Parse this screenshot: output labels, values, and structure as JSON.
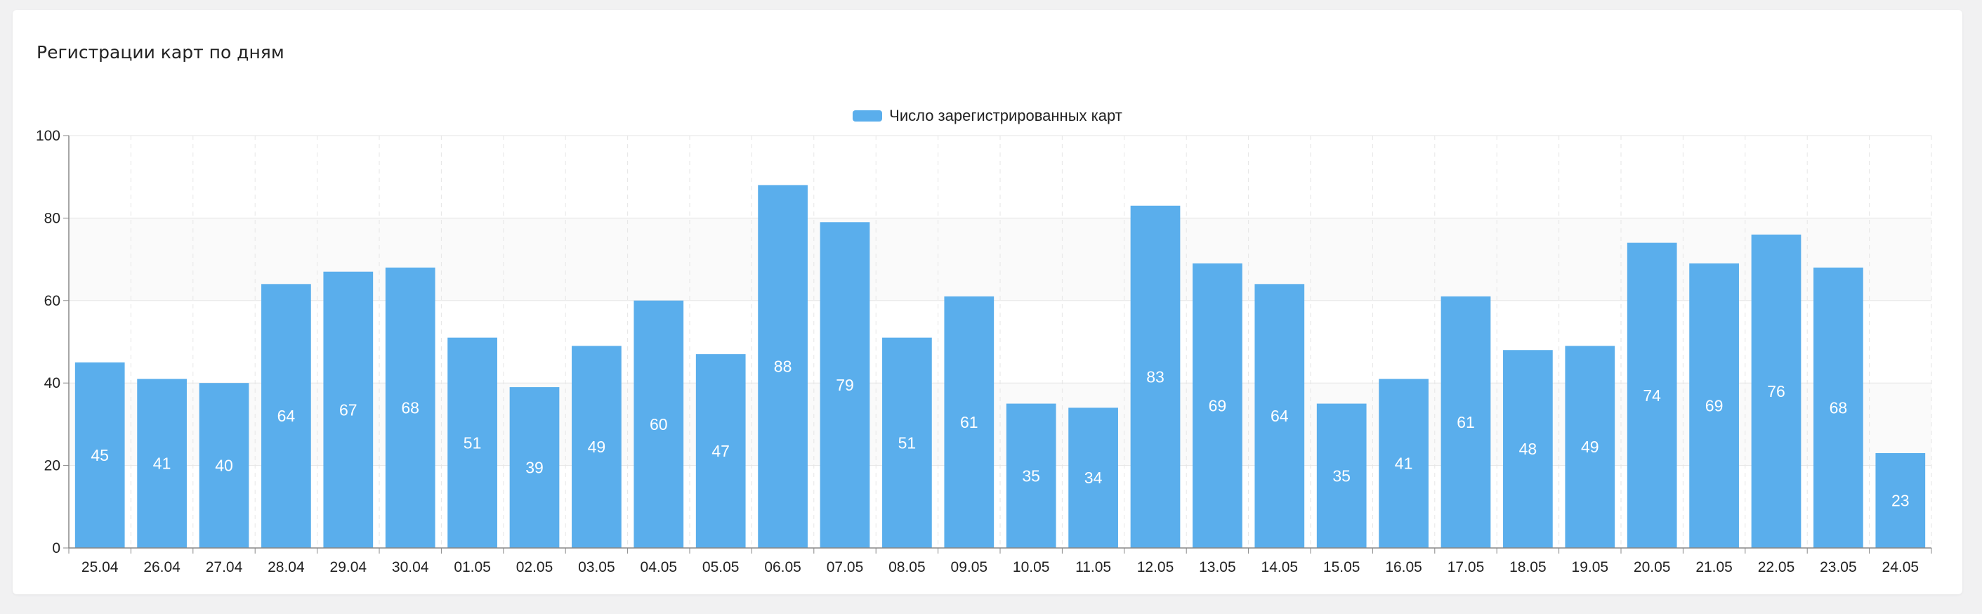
{
  "card": {
    "title": "Регистрации карт по дням"
  },
  "colors": {
    "bar": "#5aaeec",
    "grid": "#e6e6e6",
    "axis": "#888888",
    "band": "#fafafa"
  },
  "chart_data": {
    "type": "bar",
    "title": "Регистрации карт по дням",
    "xlabel": "",
    "ylabel": "",
    "ylim": [
      0,
      100
    ],
    "yticks": [
      0,
      20,
      40,
      60,
      80,
      100
    ],
    "grid": true,
    "legend_position": "top-center",
    "categories": [
      "25.04",
      "26.04",
      "27.04",
      "28.04",
      "29.04",
      "30.04",
      "01.05",
      "02.05",
      "03.05",
      "04.05",
      "05.05",
      "06.05",
      "07.05",
      "08.05",
      "09.05",
      "10.05",
      "11.05",
      "12.05",
      "13.05",
      "14.05",
      "15.05",
      "16.05",
      "17.05",
      "18.05",
      "19.05",
      "20.05",
      "21.05",
      "22.05",
      "23.05",
      "24.05"
    ],
    "series": [
      {
        "name": "Число зарегистрированных карт",
        "values": [
          45,
          41,
          40,
          64,
          67,
          68,
          51,
          39,
          49,
          60,
          47,
          88,
          79,
          51,
          61,
          35,
          34,
          83,
          69,
          64,
          35,
          41,
          61,
          48,
          49,
          74,
          69,
          76,
          68,
          23
        ]
      }
    ]
  }
}
